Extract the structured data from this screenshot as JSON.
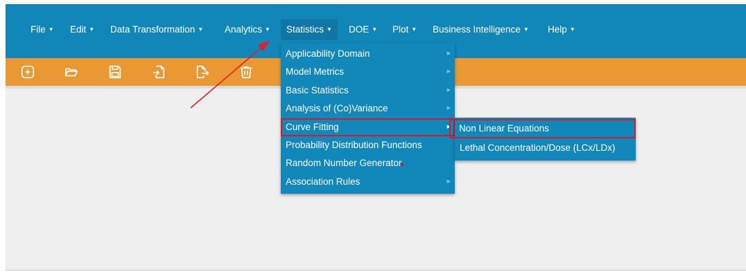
{
  "menubar": {
    "items": [
      {
        "label": "File"
      },
      {
        "label": "Edit"
      },
      {
        "label": "Data Transformation"
      },
      {
        "label": "Analytics"
      },
      {
        "label": "Statistics"
      },
      {
        "label": "DOE"
      },
      {
        "label": "Plot"
      },
      {
        "label": "Business Intelligence"
      },
      {
        "label": "Help"
      }
    ],
    "caret": "▼",
    "active": "Statistics"
  },
  "toolbar": {
    "icons": [
      "new-file-icon",
      "open-folder-icon",
      "save-icon",
      "import-icon",
      "export-icon",
      "delete-icon"
    ]
  },
  "statistics_menu": {
    "items": [
      {
        "label": "Applicability Domain",
        "has_submenu": true
      },
      {
        "label": "Model Metrics",
        "has_submenu": true
      },
      {
        "label": "Basic Statistics",
        "has_submenu": true
      },
      {
        "label": "Analysis of (Co)Variance",
        "has_submenu": true
      },
      {
        "label": "Curve Fitting",
        "has_submenu": true,
        "highlighted": true
      },
      {
        "label": "Probability Distribution Functions",
        "has_submenu": false
      },
      {
        "label": "Random Number Generator",
        "has_submenu": false
      },
      {
        "label": "Association Rules",
        "has_submenu": true
      }
    ],
    "arrow": "▶"
  },
  "curve_fitting_submenu": {
    "items": [
      {
        "label": "Non Linear Equations",
        "highlighted": true
      },
      {
        "label": "Lethal Concentration/Dose (LCx/LDx)"
      }
    ]
  },
  "colors": {
    "menubar": "#1186b8",
    "toolbar": "#ea9834",
    "dropdown": "#1287b9",
    "highlight_box": "#d8192a",
    "annotation_arrow": "#e0202a"
  }
}
